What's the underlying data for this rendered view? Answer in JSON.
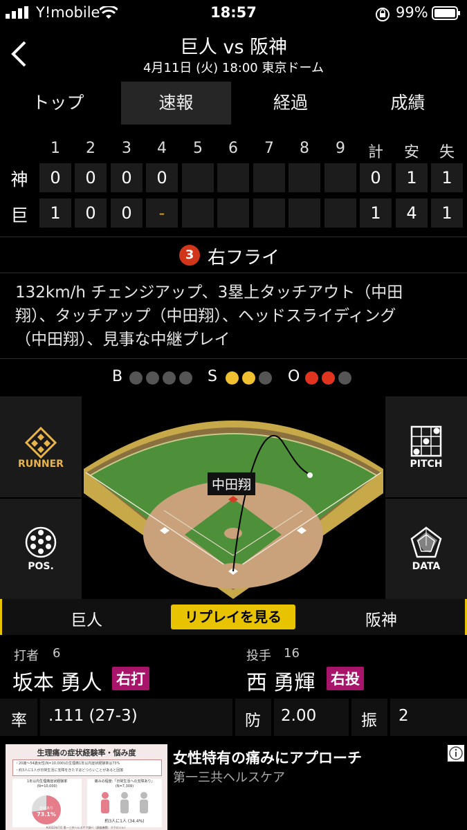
{
  "status": {
    "carrier": "Y!mobile",
    "time": "18:57",
    "battery": "99%"
  },
  "header": {
    "title": "巨人 vs 阪神",
    "subtitle": "4月11日 (火) 18:00 東京ドーム"
  },
  "tabs": [
    {
      "label": "トップ",
      "active": false
    },
    {
      "label": "速報",
      "active": true
    },
    {
      "label": "経過",
      "active": false
    },
    {
      "label": "成績",
      "active": false
    }
  ],
  "scoreboard": {
    "columns": [
      "1",
      "2",
      "3",
      "4",
      "5",
      "6",
      "7",
      "8",
      "9",
      "計",
      "安",
      "失"
    ],
    "rows": [
      {
        "team": "神",
        "cells": [
          "0",
          "0",
          "0",
          "0",
          "",
          "",
          "",
          "",
          "",
          "0",
          "1",
          "1"
        ]
      },
      {
        "team": "巨",
        "cells": [
          "1",
          "0",
          "0",
          "-",
          "",
          "",
          "",
          "",
          "",
          "1",
          "4",
          "1"
        ]
      }
    ]
  },
  "play": {
    "number": "3",
    "result": "右フライ",
    "description_lines": [
      "132km/h チェンジアップ、3塁上タッチアウト（中田",
      "翔）、タッチアップ（中田翔）、ヘッドスライディング",
      "（中田翔）、見事な中継プレイ"
    ]
  },
  "count": {
    "b_label": "B",
    "s_label": "S",
    "o_label": "O",
    "balls": 0,
    "strikes": 2,
    "outs": 2
  },
  "field": {
    "runner_tag": "中田翔"
  },
  "side_buttons": {
    "runner": "RUNNER",
    "pos": "POS.",
    "pitch": "PITCH",
    "data": "DATA"
  },
  "teambar": {
    "home": "巨人",
    "replay": "リプレイを見る",
    "away": "阪神"
  },
  "batter": {
    "label": "打者",
    "number": "6",
    "name": "坂本 勇人",
    "hand": "右打",
    "stat_label": "率",
    "stat_value": ".111 (27-3)"
  },
  "pitcher": {
    "label": "投手",
    "number": "16",
    "name": "西 勇輝",
    "hand": "右投",
    "stat1_label": "防",
    "stat1_value": "2.00",
    "stat2_label": "振",
    "stat2_value": "2"
  },
  "ad": {
    "headline": "女性特有の痛みにアプローチ",
    "sponsor": "第一三共ヘルスケア",
    "img_title": "生理痛の症状経験率・悩み度",
    "img_note1": "・20歳～54歳女性(N=10,000)の生理痛1年以内症状経験率は73%",
    "img_note2": "・約3人に1人が日常生活に支障をきたすほどつらいことがあると回答",
    "img_left": "1年以内生理痛症状経験率",
    "img_left_n": "(N=10,000)",
    "img_right": "痛みの程度:「日常生活への支障あり」",
    "img_right_n": "(N=7,309)",
    "img_pct": "73.1%",
    "img_pie_label": "症状あり",
    "img_ratio": "約3人に1人 (34.4%)",
    "img_foot": "※2022年7月 第一三共ヘルスケア調べ（調査機関：マクロミル）"
  },
  "colors": {
    "accent_yellow": "#e8c300",
    "out_red": "#e1341e",
    "badge_magenta": "#a8146a",
    "strike_yellow": "#f0c030"
  }
}
